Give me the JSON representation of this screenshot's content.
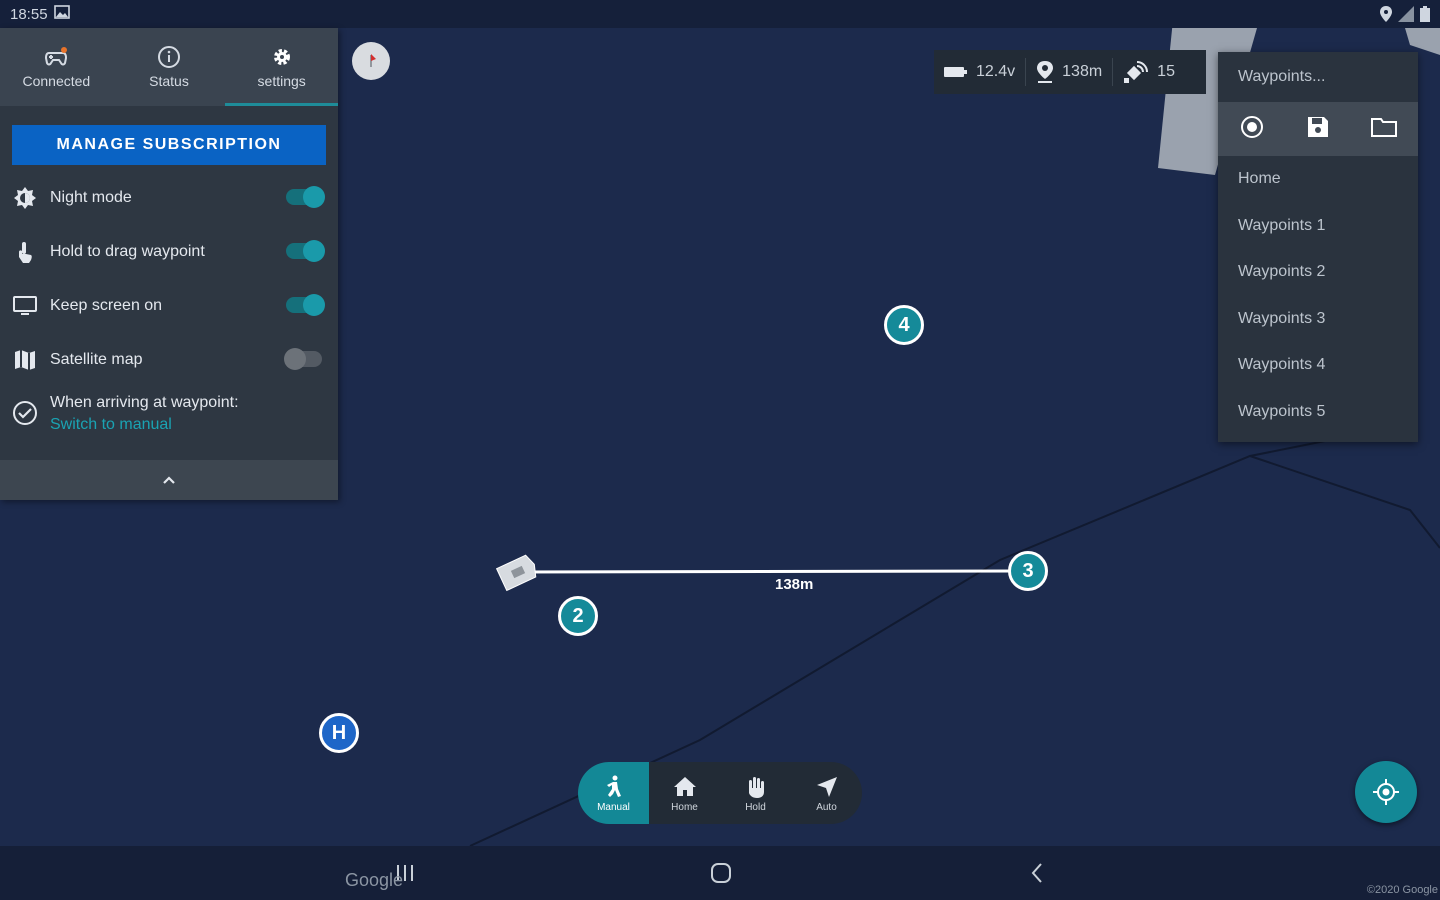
{
  "status_bar": {
    "time": "18:55"
  },
  "tabs": [
    {
      "label": "Connected",
      "icon": "gamepad-icon"
    },
    {
      "label": "Status",
      "icon": "info-icon"
    },
    {
      "label": "settings",
      "icon": "gear-icon"
    }
  ],
  "settings": {
    "manage_label": "MANAGE SUBSCRIPTION",
    "night_mode": {
      "label": "Night mode",
      "on": true
    },
    "hold_drag": {
      "label": "Hold to drag waypoint",
      "on": true
    },
    "keep_screen": {
      "label": "Keep screen on",
      "on": true
    },
    "satellite": {
      "label": "Satellite map",
      "on": false
    },
    "arrive": {
      "label": "When arriving at waypoint:",
      "value": "Switch to manual"
    }
  },
  "telemetry": {
    "battery": "12.4v",
    "distance": "138m",
    "satellites": "15"
  },
  "waypoints_menu": {
    "header": "Waypoints...",
    "items": [
      "Home",
      "Waypoints 1",
      "Waypoints 2",
      "Waypoints 3",
      "Waypoints 4",
      "Waypoints 5"
    ]
  },
  "map": {
    "markers": {
      "wp2": "2",
      "wp3": "3",
      "wp4": "4",
      "home": "H"
    },
    "distance_label": "138m",
    "attribution": "Google",
    "copyright": "©2020 Google"
  },
  "modes": [
    {
      "label": "Manual",
      "active": true
    },
    {
      "label": "Home",
      "active": false
    },
    {
      "label": "Hold",
      "active": false
    },
    {
      "label": "Auto",
      "active": false
    }
  ],
  "colors": {
    "accent": "#138896",
    "primary_button": "#0a63c4",
    "map_bg": "#1c2a4c",
    "link": "#1aa3b3"
  }
}
